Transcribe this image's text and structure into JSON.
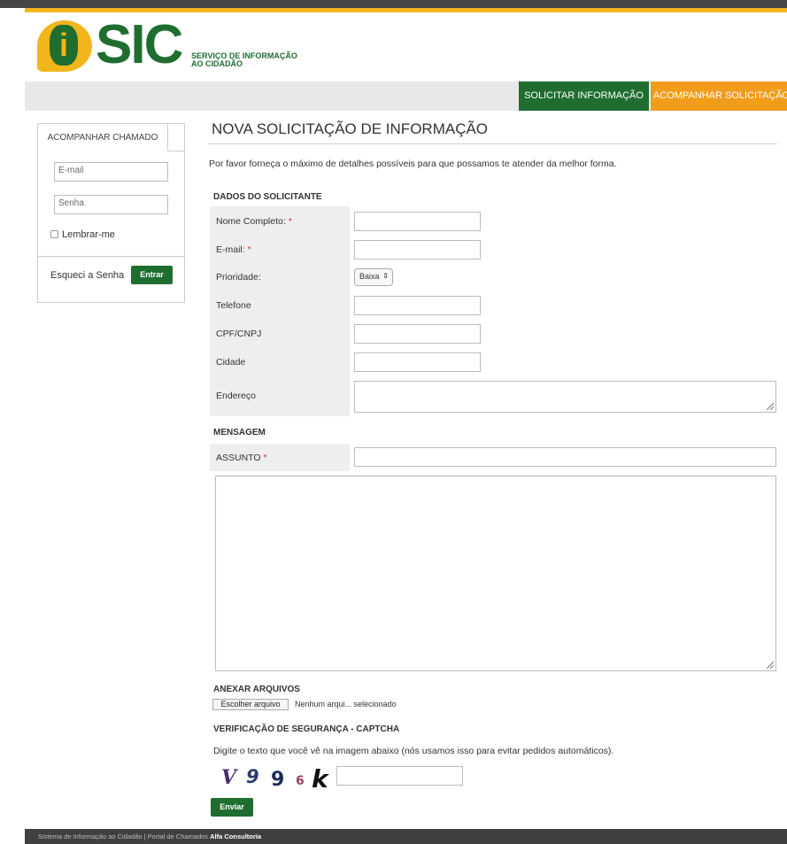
{
  "brand": {
    "logo_mark": "i",
    "logo_name": "SIC",
    "subtitle_line1": "SERVIÇO DE INFORMAÇÃO",
    "subtitle_line2": "AO CIDADÃO",
    "colors": {
      "green": "#1f6e30",
      "yellow": "#f2b51c",
      "orange": "#f29c1c"
    }
  },
  "nav": {
    "solicitar": "SOLICITAR INFORMAÇÃO",
    "acompanhar": "ACOMPANHAR SOLICITAÇÃO"
  },
  "sidebar": {
    "tab": "ACOMPANHAR CHAMADO",
    "email_placeholder": "E-mail",
    "senha_placeholder": "Senha",
    "remember": "Lembrar-me",
    "forgot": "Esqueci a Senha",
    "entrar": "Entrar"
  },
  "form": {
    "title": "NOVA SOLICITAÇÃO DE INFORMAÇÃO",
    "intro": "Por favor forneça o máximo de detalhes possíveis para que possamos te atender da melhor forma.",
    "section_dados": "DADOS DO SOLICITANTE",
    "fields": {
      "nome": "Nome Completo:",
      "email": "E-mail:",
      "prioridade": "Prioridade:",
      "telefone": "Telefone",
      "cpf": "CPF/CNPJ",
      "cidade": "Cidade",
      "endereco": "Endereço"
    },
    "required_mark": "*",
    "prioridade_value": "Baixa",
    "section_mensagem": "MENSAGEM",
    "assunto": "ASSUNTO",
    "section_anexar": "ANEXAR ARQUIVOS",
    "file_button": "Escolher arquivo",
    "file_status": "Nenhum arqui... selecionado",
    "section_verificacao": "VERIFICAÇÃO DE SEGURANÇA - CAPTCHA",
    "captcha_help": "Digite o texto que você vê na imagem abaixo (nós usamos isso para evitar pedidos automáticos).",
    "captcha_chars": [
      "V",
      "9",
      "9",
      "6",
      "k"
    ],
    "enviar": "Enviar"
  },
  "footer": {
    "text": "Sistema de Informação ao Cidadão | Portal de Chamados ",
    "brand": "Alfa Consultoria"
  }
}
